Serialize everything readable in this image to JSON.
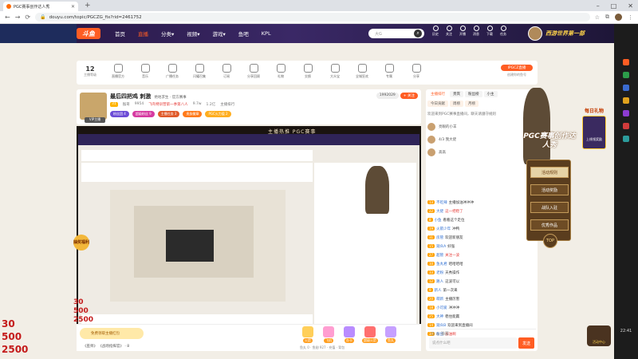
{
  "browser": {
    "tab_title": "PGC赛事创作达人秀",
    "new_tab": "+",
    "window_controls": [
      "–",
      "□",
      "✕"
    ],
    "url": "douyu.com/topic/PGCZG_fix?rid=2461752",
    "nav_icons": [
      "←",
      "→",
      "⟳"
    ]
  },
  "douyu_nav": {
    "logo": "斗鱼",
    "menu": [
      {
        "label": "首页",
        "active": false
      },
      {
        "label": "直播",
        "active": true
      },
      {
        "label": "分类▾",
        "active": false
      },
      {
        "label": "视频▾",
        "active": false
      },
      {
        "label": "游戏▾",
        "active": false
      },
      {
        "label": "鱼吧",
        "active": false
      },
      {
        "label": "KPL",
        "active": false
      }
    ],
    "search_placeholder": "大G",
    "icons": [
      "历史",
      "关注",
      "开播",
      "消息",
      "下载",
      "任务"
    ],
    "banner_text": "西游世界第一部"
  },
  "toolbar": {
    "count": "12",
    "count_label": "主播等级",
    "items": [
      "直播官方",
      "音乐",
      "广播任务",
      "闪耀召集",
      "订阅",
      "分享回顾",
      "礼物",
      "交换",
      "大众宝",
      "全城狂欢",
      "专属",
      "分享"
    ],
    "right_pill": "IPGCZ直播",
    "right_sub": "创建你的鱼号"
  },
  "host": {
    "title": "最后四把鸡 刺激",
    "category": "绝地求生 · 官方赛事",
    "level": "31",
    "meta": [
      "猴哥",
      "9954",
      "PGC创作达人",
      "直播大厅",
      "9.7w",
      "1.2亿",
      "主播排行"
    ],
    "meta_red": "飞鸟特训营第一季第八人",
    "tags": [
      {
        "label": "粉丝团 4",
        "color": "#6c4cd6"
      },
      {
        "label": "超级粉丝 9",
        "color": "#d63aa1"
      },
      {
        "label": "主播任务 3",
        "color": "#e05a2a"
      },
      {
        "label": "贵族徽章",
        "color": "#ff7a1a"
      },
      {
        "label": "PGC火力值 2",
        "color": "#ffae1f"
      }
    ],
    "fans": [
      {
        "label": "1992029",
        "bg": "#eee",
        "fg": "#555"
      },
      {
        "label": "+ 关注",
        "bg": "#ff5d23",
        "fg": "#fff"
      }
    ],
    "badge": "VIP主播"
  },
  "video": {
    "title_overlay": "主播热推 PGC赛事",
    "counter": [
      "30",
      "500",
      "2500"
    ]
  },
  "bottom": {
    "gift_label": "免费领取主播红包",
    "message": "《巫师》 《战场指挥官》 · 8",
    "gifts": [
      {
        "label": "火箭",
        "color": "#ffcf5a"
      },
      {
        "label": "飞机",
        "color": "#ff9ed1"
      },
      {
        "label": "办卡",
        "color": "#b98cff"
      },
      {
        "label": "超级火箭",
        "color": "#ff6f6f"
      },
      {
        "label": "鱼丸",
        "color": "#c6a0ff"
      }
    ],
    "stats": "鱼丸 0 · 鱼翅 927 · 充值 · 背包"
  },
  "chat": {
    "tabs": [
      "主播排行",
      "贵宾",
      "粉丝榜",
      "小主"
    ],
    "subtabs": [
      "今日贡献",
      "周榜",
      "月榜"
    ],
    "notice": "欢迎来到PGC赛事直播间，聊天请遵守规则",
    "ranks": [
      "亮眼的小羊",
      "4/3 我大佬",
      "高高"
    ],
    "messages": [
      {
        "lv": "13",
        "user": "不吃辣",
        "text": "主播加油冲冲冲"
      },
      {
        "lv": "22",
        "user": "大佬",
        "text": "这一把稳了",
        "red": true
      },
      {
        "lv": "8",
        "user": "小鱼",
        "text": "看看这个走位"
      },
      {
        "lv": "19",
        "user": "火箭少年",
        "text": "冲鸭"
      },
      {
        "lv": "31",
        "user": "房管",
        "text": "欢迎新朋友"
      },
      {
        "lv": "15",
        "user": "观众A",
        "text": "好强"
      },
      {
        "lv": "27",
        "user": "超管",
        "text": "关注一波",
        "red": true
      },
      {
        "lv": "10",
        "user": "鱼丸君",
        "text": "哈哈哈哈"
      },
      {
        "lv": "33",
        "user": "老粉",
        "text": "天秀操作"
      },
      {
        "lv": "12",
        "user": "路人",
        "text": "这波可以"
      },
      {
        "lv": "9",
        "user": "新人",
        "text": "第一次来"
      },
      {
        "lv": "20",
        "user": "萌新",
        "text": "主播厉害"
      },
      {
        "lv": "18",
        "user": "小可爱",
        "text": "冲冲冲"
      },
      {
        "lv": "25",
        "user": "大神",
        "text": "稳住能赢"
      },
      {
        "lv": "14",
        "user": "观众B",
        "text": "欢迎来到直播间"
      },
      {
        "lv": "30",
        "user": "粉丝",
        "text": "加油啊",
        "red": true
      }
    ],
    "input_placeholder": "说点什么吧",
    "send": "发送",
    "input_icons": "☺ ◎ 弹幕"
  },
  "pgc_panel": {
    "title": "PGC赛事创作达人秀",
    "buttons": [
      "活动规则",
      "活动奖励",
      "战队入驻",
      "优秀作品"
    ],
    "top": "TOP"
  },
  "side_gift": {
    "title": "每日礼物",
    "card": "上线领奖励"
  },
  "round_gift": "抽奖福利",
  "right_badge": "活动中心",
  "right_strip_colors": [
    "#ff5d23",
    "#2c9c4a",
    "#3a6bd1",
    "#e0a21e",
    "#8c3bd1",
    "#d13b3b",
    "#2c9c9c"
  ],
  "right_strip_clock": "22:41"
}
